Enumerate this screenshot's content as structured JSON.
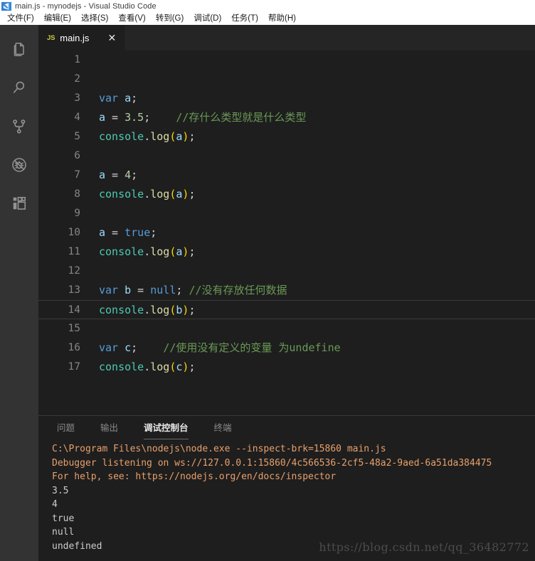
{
  "window": {
    "title": "main.js - mynodejs - Visual Studio Code",
    "logo_icon": "vscode-logo-icon"
  },
  "menubar": {
    "items": [
      {
        "label": "文件(F)",
        "name": "menu-file"
      },
      {
        "label": "编辑(E)",
        "name": "menu-edit"
      },
      {
        "label": "选择(S)",
        "name": "menu-selection"
      },
      {
        "label": "查看(V)",
        "name": "menu-view"
      },
      {
        "label": "转到(G)",
        "name": "menu-goto"
      },
      {
        "label": "调试(D)",
        "name": "menu-debug"
      },
      {
        "label": "任务(T)",
        "name": "menu-tasks"
      },
      {
        "label": "帮助(H)",
        "name": "menu-help"
      }
    ]
  },
  "activitybar": {
    "items": [
      {
        "icon": "files-explorer-icon",
        "name": "activity-explorer"
      },
      {
        "icon": "search-icon",
        "name": "activity-search"
      },
      {
        "icon": "source-control-branch-icon",
        "name": "activity-source-control"
      },
      {
        "icon": "debug-bug-no-icon",
        "name": "activity-debug"
      },
      {
        "icon": "extensions-squares-icon",
        "name": "activity-extensions"
      }
    ]
  },
  "editor": {
    "tab": {
      "file_type": "JS",
      "label": "main.js",
      "close_glyph": "✕"
    },
    "current_line": 14,
    "lines": [
      {
        "n": "1",
        "segments": []
      },
      {
        "n": "2",
        "segments": []
      },
      {
        "n": "3",
        "segments": [
          {
            "t": "var",
            "c": "tk-kw"
          },
          {
            "t": " ",
            "c": "tk-pn"
          },
          {
            "t": "a",
            "c": "tk-var"
          },
          {
            "t": ";",
            "c": "tk-pn"
          }
        ]
      },
      {
        "n": "4",
        "segments": [
          {
            "t": "a",
            "c": "tk-var"
          },
          {
            "t": " = ",
            "c": "tk-pn"
          },
          {
            "t": "3.5",
            "c": "tk-num"
          },
          {
            "t": ";",
            "c": "tk-pn"
          },
          {
            "t": "    ",
            "c": "tk-pn"
          },
          {
            "t": "//存什么类型就是什么类型",
            "c": "tk-cmt"
          }
        ]
      },
      {
        "n": "5",
        "segments": [
          {
            "t": "console",
            "c": "tk-obj"
          },
          {
            "t": ".",
            "c": "tk-pn"
          },
          {
            "t": "log",
            "c": "tk-fn"
          },
          {
            "t": "(",
            "c": "tk-punc-y"
          },
          {
            "t": "a",
            "c": "tk-var"
          },
          {
            "t": ")",
            "c": "tk-punc-y"
          },
          {
            "t": ";",
            "c": "tk-pn"
          }
        ]
      },
      {
        "n": "6",
        "segments": []
      },
      {
        "n": "7",
        "segments": [
          {
            "t": "a",
            "c": "tk-var"
          },
          {
            "t": " = ",
            "c": "tk-pn"
          },
          {
            "t": "4",
            "c": "tk-num"
          },
          {
            "t": ";",
            "c": "tk-pn"
          }
        ]
      },
      {
        "n": "8",
        "segments": [
          {
            "t": "console",
            "c": "tk-obj"
          },
          {
            "t": ".",
            "c": "tk-pn"
          },
          {
            "t": "log",
            "c": "tk-fn"
          },
          {
            "t": "(",
            "c": "tk-punc-y"
          },
          {
            "t": "a",
            "c": "tk-var"
          },
          {
            "t": ")",
            "c": "tk-punc-y"
          },
          {
            "t": ";",
            "c": "tk-pn"
          }
        ]
      },
      {
        "n": "9",
        "segments": []
      },
      {
        "n": "10",
        "segments": [
          {
            "t": "a",
            "c": "tk-var"
          },
          {
            "t": " = ",
            "c": "tk-pn"
          },
          {
            "t": "true",
            "c": "tk-kw"
          },
          {
            "t": ";",
            "c": "tk-pn"
          }
        ]
      },
      {
        "n": "11",
        "segments": [
          {
            "t": "console",
            "c": "tk-obj"
          },
          {
            "t": ".",
            "c": "tk-pn"
          },
          {
            "t": "log",
            "c": "tk-fn"
          },
          {
            "t": "(",
            "c": "tk-punc-y"
          },
          {
            "t": "a",
            "c": "tk-var"
          },
          {
            "t": ")",
            "c": "tk-punc-y"
          },
          {
            "t": ";",
            "c": "tk-pn"
          }
        ]
      },
      {
        "n": "12",
        "segments": []
      },
      {
        "n": "13",
        "segments": [
          {
            "t": "var",
            "c": "tk-kw"
          },
          {
            "t": " ",
            "c": "tk-pn"
          },
          {
            "t": "b",
            "c": "tk-var"
          },
          {
            "t": " = ",
            "c": "tk-pn"
          },
          {
            "t": "null",
            "c": "tk-kw"
          },
          {
            "t": "; ",
            "c": "tk-pn"
          },
          {
            "t": "//没有存放任何数据",
            "c": "tk-cmt"
          }
        ]
      },
      {
        "n": "14",
        "segments": [
          {
            "t": "console",
            "c": "tk-obj"
          },
          {
            "t": ".",
            "c": "tk-pn"
          },
          {
            "t": "log",
            "c": "tk-fn"
          },
          {
            "t": "(",
            "c": "tk-punc-y"
          },
          {
            "t": "b",
            "c": "tk-var"
          },
          {
            "t": ")",
            "c": "tk-punc-y"
          },
          {
            "t": ";",
            "c": "tk-pn"
          }
        ]
      },
      {
        "n": "15",
        "segments": []
      },
      {
        "n": "16",
        "segments": [
          {
            "t": "var",
            "c": "tk-kw"
          },
          {
            "t": " ",
            "c": "tk-pn"
          },
          {
            "t": "c",
            "c": "tk-var"
          },
          {
            "t": ";",
            "c": "tk-pn"
          },
          {
            "t": "    ",
            "c": "tk-pn"
          },
          {
            "t": "//使用没有定义的变量 为undefine",
            "c": "tk-cmt"
          }
        ]
      },
      {
        "n": "17",
        "segments": [
          {
            "t": "console",
            "c": "tk-obj"
          },
          {
            "t": ".",
            "c": "tk-pn"
          },
          {
            "t": "log",
            "c": "tk-fn"
          },
          {
            "t": "(",
            "c": "tk-punc-y"
          },
          {
            "t": "c",
            "c": "tk-var"
          },
          {
            "t": ")",
            "c": "tk-punc-y"
          },
          {
            "t": ";",
            "c": "tk-pn"
          }
        ]
      }
    ]
  },
  "panel": {
    "tabs": [
      {
        "label": "问题",
        "name": "panel-tab-problems",
        "active": false
      },
      {
        "label": "输出",
        "name": "panel-tab-output",
        "active": false
      },
      {
        "label": "调试控制台",
        "name": "panel-tab-debug-console",
        "active": true
      },
      {
        "label": "终端",
        "name": "panel-tab-terminal",
        "active": false
      }
    ],
    "console_lines": [
      {
        "text": "C:\\Program Files\\nodejs\\node.exe --inspect-brk=15860 main.js",
        "kind": "meta"
      },
      {
        "text": "Debugger listening on ws://127.0.0.1:15860/4c566536-2cf5-48a2-9aed-6a51da384475",
        "kind": "meta"
      },
      {
        "text": "For help, see: https://nodejs.org/en/docs/inspector",
        "kind": "meta"
      },
      {
        "text": "3.5",
        "kind": "out"
      },
      {
        "text": "4",
        "kind": "out"
      },
      {
        "text": "true",
        "kind": "out"
      },
      {
        "text": "null",
        "kind": "out"
      },
      {
        "text": "undefined",
        "kind": "out"
      }
    ]
  },
  "watermark": {
    "text": "https://blog.csdn.net/qq_36482772"
  },
  "colors": {
    "activity_bar_bg": "#333333",
    "editor_bg": "#1e1e1e",
    "tabs_bg": "#252526",
    "titlebar_bg": "#ffffff",
    "keyword": "#569cd6",
    "variable": "#9cdcfe",
    "number": "#b5cea8",
    "comment": "#6a9955",
    "object": "#4ec9b0",
    "function": "#dcdcaa",
    "console_meta": "#e8a06c",
    "console_out": "#cccccc",
    "js_badge": "#cbcb41"
  }
}
